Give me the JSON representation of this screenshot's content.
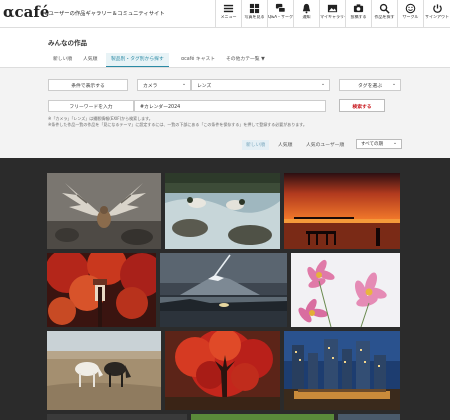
{
  "header": {
    "logo": "αcafé",
    "tagline": "αユーザーの作品ギャラリー＆コミュニティサイト",
    "nav": [
      {
        "label": "メニュー",
        "icon": "menu-icon"
      },
      {
        "label": "写真を見る",
        "icon": "photos-icon"
      },
      {
        "label": "Q&A・サークル",
        "icon": "chat-icon"
      },
      {
        "label": "通知",
        "icon": "bell-icon"
      },
      {
        "label": "マイギャラリー",
        "icon": "gallery-icon"
      },
      {
        "label": "投稿する",
        "icon": "camera-icon"
      },
      {
        "label": "作品を探す",
        "icon": "search-icon"
      },
      {
        "label": "サークル",
        "icon": "smile-icon"
      },
      {
        "label": "サインアウト",
        "icon": "signout-icon"
      }
    ]
  },
  "page_title": "みんなの作品",
  "tabs": [
    "新しい順",
    "人気順",
    "製品別・タグ別から探す",
    "αcafé キャスト",
    "その他カテ一覧 ▼"
  ],
  "filters": {
    "condition_label": "条件で表示する",
    "camera": "カメラ",
    "lens": "レンズ",
    "tag": "タグを選ぶ",
    "freeword_label": "フリーワードを入力",
    "freeword_value": "#カレンダー2024",
    "search_button": "検索する"
  },
  "notes": [
    "※「カメラ」「レンズ」は撮影情報(EXIF)から検索します。",
    "※条件した作品一覧の作品を「見になるテーマ」に設定するには、一覧の下部にある「この条件を保存する」を押して登録する必要があります。"
  ],
  "sort": {
    "options": [
      "新しい順",
      "人気順",
      "人気のユーザー順"
    ],
    "period": "すべての期"
  },
  "photos": [
    "bird-wings-photo",
    "ducks-stream-photo",
    "sunset-pier-photo",
    "autumn-maple-photo",
    "mount-fuji-night-photo",
    "cosmos-flowers-photo",
    "horses-grassland-photo",
    "red-tree-photo",
    "city-night-photo"
  ]
}
